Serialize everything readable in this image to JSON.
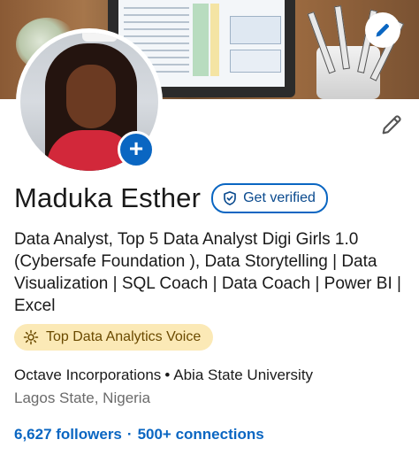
{
  "profile": {
    "name": "Maduka Esther",
    "verify_label": "Get verified",
    "headline": "Data Analyst, Top 5 Data Analyst Digi Girls 1.0 (Cybersafe Foundation ), Data Storytelling | Data Visualization | SQL Coach | Data Coach | Power BI | Excel",
    "badge_label": "Top Data Analytics Voice",
    "company": "Octave Incorporations",
    "school": "Abia State University",
    "location": "Lagos State, Nigeria",
    "followers": "6,627 followers",
    "connections": "500+ connections"
  },
  "icons": {
    "cover_edit": "pencil-icon",
    "intro_edit": "pencil-icon",
    "add_photo": "plus-icon",
    "verify": "shield-check-icon",
    "badge": "sun-icon"
  },
  "colors": {
    "accent": "#0a66c2",
    "badge_bg": "#fbe9b6",
    "muted_text": "#6b6b6b"
  }
}
